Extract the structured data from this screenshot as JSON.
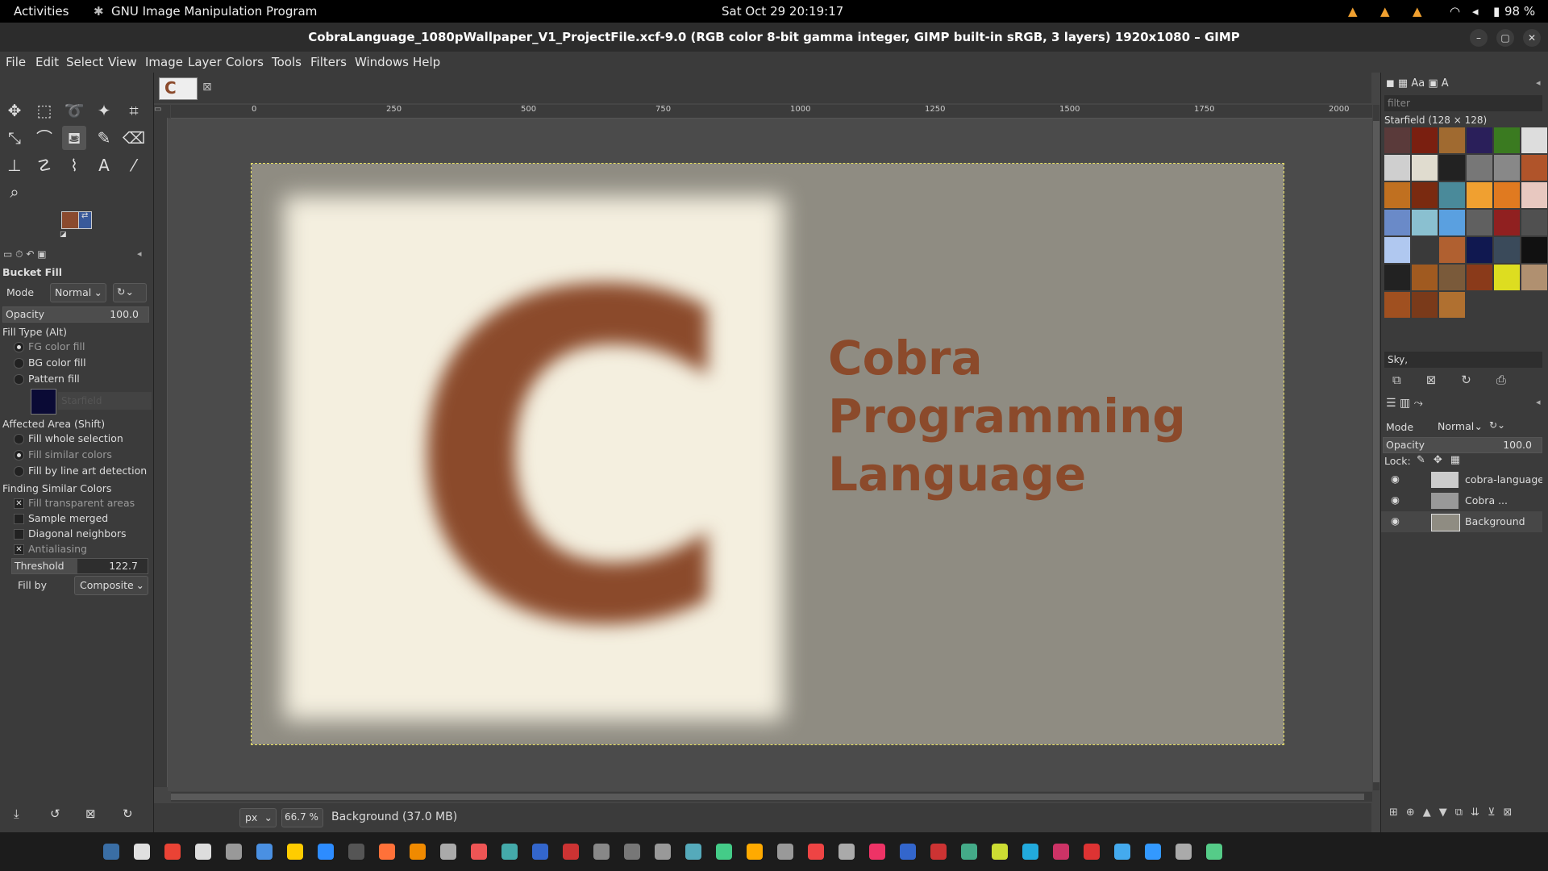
{
  "topbar": {
    "activities": "Activities",
    "app_name": "GNU Image Manipulation Program",
    "clock": "Sat Oct 29  20:19:17",
    "battery": "98 %"
  },
  "window": {
    "title": "CobraLanguage_1080pWallpaper_V1_ProjectFile.xcf-9.0 (RGB color 8-bit gamma integer, GIMP built-in sRGB, 3 layers) 1920x1080 – GIMP"
  },
  "menubar": [
    "File",
    "Edit",
    "Select",
    "View",
    "Image",
    "Layer",
    "Colors",
    "Tools",
    "Filters",
    "Windows",
    "Help"
  ],
  "tool_options": {
    "title": "Bucket Fill",
    "mode_label": "Mode",
    "mode_value": "Normal",
    "opacity_label": "Opacity",
    "opacity_value": "100.0",
    "fill_type_label": "Fill Type  (Alt)",
    "fill_types": [
      "FG color fill",
      "BG color fill",
      "Pattern fill"
    ],
    "pattern_name": "Starfield",
    "affected_area_label": "Affected Area  (Shift)",
    "affected_areas": [
      "Fill whole selection",
      "Fill similar colors",
      "Fill by line art detection"
    ],
    "similar_label": "Finding Similar Colors",
    "similar_options": [
      "Fill transparent areas",
      "Sample merged",
      "Diagonal neighbors",
      "Antialiasing"
    ],
    "threshold_label": "Threshold",
    "threshold_value": "122.7",
    "fillby_label": "Fill by",
    "fillby_value": "Composite"
  },
  "colors": {
    "fg": "#8a4a2e",
    "bg": "#3a5a9a",
    "accent": "#8b4a2b"
  },
  "ruler_ticks": [
    "0",
    "250",
    "500",
    "750",
    "1000",
    "1250",
    "1500",
    "1750",
    "2000"
  ],
  "image": {
    "logo_letter": "C",
    "line1": "Cobra",
    "line2": "Programming",
    "line3": "Language"
  },
  "statusbar": {
    "unit": "px",
    "zoom": "66.7 %",
    "info": "Background (37.0 MB)"
  },
  "patterns": {
    "filter_placeholder": "filter",
    "current": "Starfield (128 × 128)",
    "tag": "Sky,"
  },
  "layers": {
    "mode_label": "Mode",
    "mode_value": "Normal",
    "opacity_label": "Opacity",
    "opacity_value": "100.0",
    "lock_label": "Lock:",
    "items": [
      {
        "name": "cobra-language"
      },
      {
        "name": "Cobra ..."
      },
      {
        "name": "Background"
      }
    ]
  }
}
